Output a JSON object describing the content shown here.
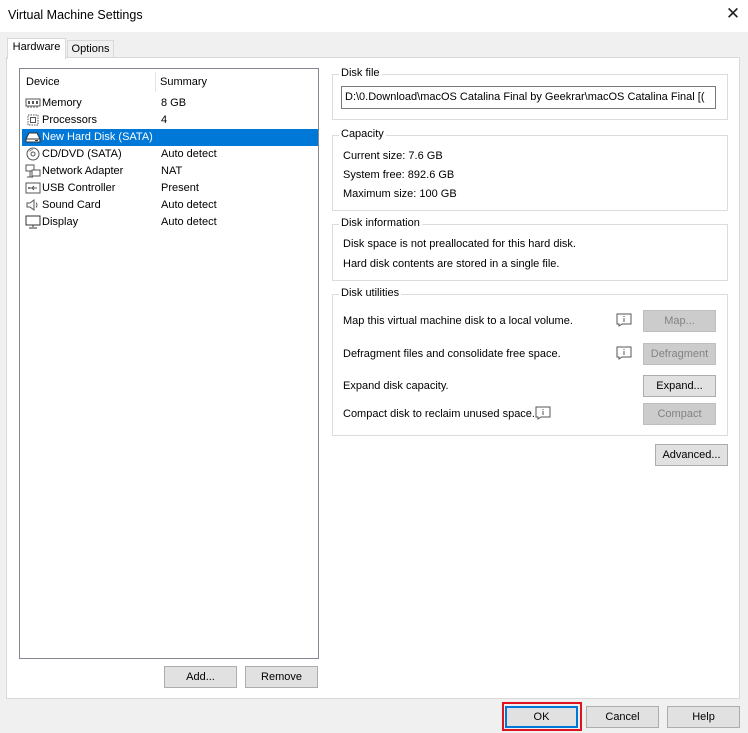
{
  "window": {
    "title": "Virtual Machine Settings"
  },
  "tabs": [
    {
      "label": "Hardware",
      "active": true
    },
    {
      "label": "Options",
      "active": false
    }
  ],
  "device_list": {
    "headers": {
      "device": "Device",
      "summary": "Summary"
    },
    "items": [
      {
        "name": "Memory",
        "summary": "8 GB",
        "icon": "memory-icon"
      },
      {
        "name": "Processors",
        "summary": "4",
        "icon": "processor-icon"
      },
      {
        "name": "New Hard Disk (SATA)",
        "summary": "",
        "icon": "hard-disk-icon",
        "selected": true
      },
      {
        "name": "CD/DVD (SATA)",
        "summary": "Auto detect",
        "icon": "cd-dvd-icon"
      },
      {
        "name": "Network Adapter",
        "summary": "NAT",
        "icon": "network-adapter-icon"
      },
      {
        "name": "USB Controller",
        "summary": "Present",
        "icon": "usb-icon"
      },
      {
        "name": "Sound Card",
        "summary": "Auto detect",
        "icon": "speaker-icon"
      },
      {
        "name": "Display",
        "summary": "Auto detect",
        "icon": "monitor-icon"
      }
    ],
    "add_label": "Add...",
    "remove_label": "Remove"
  },
  "disk_file": {
    "title": "Disk file",
    "path": "D:\\0.Download\\macOS Catalina Final by Geekrar\\macOS Catalina Final [("
  },
  "capacity": {
    "title": "Capacity",
    "current_size": "Current size:  7.6 GB",
    "system_free": "System free:  892.6 GB",
    "maximum_size": "Maximum size:  100 GB"
  },
  "disk_info": {
    "title": "Disk information",
    "line1": "Disk space is not preallocated for this hard disk.",
    "line2": "Hard disk contents are stored in a single file."
  },
  "disk_utilities": {
    "title": "Disk utilities",
    "map_text": "Map this virtual machine disk to a local volume.",
    "map_label": "Map...",
    "defrag_text": "Defragment files and consolidate free space.",
    "defrag_label": "Defragment",
    "expand_text": "Expand disk capacity.",
    "expand_label": "Expand...",
    "compact_text": "Compact disk to reclaim unused space.",
    "compact_label": "Compact"
  },
  "advanced_label": "Advanced...",
  "footer": {
    "ok_label": "OK",
    "cancel_label": "Cancel",
    "help_label": "Help"
  },
  "colors": {
    "selection": "#0078d7",
    "highlight_box": "#e0141e"
  }
}
